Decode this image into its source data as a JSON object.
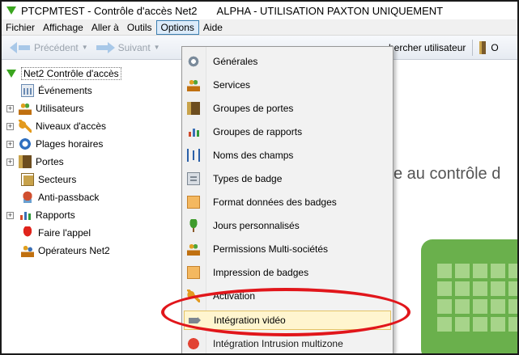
{
  "window": {
    "title": "PTCPMTEST - Contrôle d'accès Net2",
    "subtitle": "ALPHA - UTILISATION PAXTON UNIQUEMENT"
  },
  "menubar": [
    {
      "id": "fichier",
      "label": "Fichier"
    },
    {
      "id": "affichage",
      "label": "Affichage"
    },
    {
      "id": "aller",
      "label": "Aller à"
    },
    {
      "id": "outils",
      "label": "Outils"
    },
    {
      "id": "options",
      "label": "Options"
    },
    {
      "id": "aide",
      "label": "Aide"
    }
  ],
  "toolbar": {
    "back_label": "Précédent",
    "forward_label": "Suivant",
    "search_user_label": "hercher utilisateur",
    "open_door_label": "O"
  },
  "tree": {
    "root": "Net2 Contrôle d'accès",
    "items": [
      {
        "label": "Événements",
        "icon": "calendar-icon"
      },
      {
        "label": "Utilisateurs",
        "icon": "users-icon"
      },
      {
        "label": "Niveaux d'accès",
        "icon": "key-icon"
      },
      {
        "label": "Plages horaires",
        "icon": "clock-icon"
      },
      {
        "label": "Portes",
        "icon": "door-icon"
      },
      {
        "label": "Secteurs",
        "icon": "sector-icon"
      },
      {
        "label": "Anti-passback",
        "icon": "antipassback-icon"
      },
      {
        "label": "Rapports",
        "icon": "report-icon"
      },
      {
        "label": "Faire l'appel",
        "icon": "roll-call-icon"
      },
      {
        "label": "Opérateurs Net2",
        "icon": "operators-icon"
      }
    ]
  },
  "main": {
    "welcome_text": "e au contrôle d"
  },
  "options_menu": {
    "items": [
      {
        "label": "Générales"
      },
      {
        "label": "Services"
      },
      {
        "label": "Groupes de portes"
      },
      {
        "label": "Groupes de rapports"
      },
      {
        "label": "Noms des champs"
      },
      {
        "label": "Types de badge"
      },
      {
        "label": "Format données des badges"
      },
      {
        "label": "Jours personnalisés"
      },
      {
        "label": "Permissions Multi-sociétés"
      },
      {
        "label": "Impression de badges"
      },
      {
        "label": "Activation"
      },
      {
        "label": "Intégration vidéo"
      },
      {
        "label": "Intégration Intrusion multizone"
      }
    ],
    "highlighted": "Intégration vidéo"
  },
  "colors": {
    "highlight_ellipse": "#e1161b",
    "net2_green": "#3aa51f",
    "hover_bg": "#fff5cf"
  }
}
